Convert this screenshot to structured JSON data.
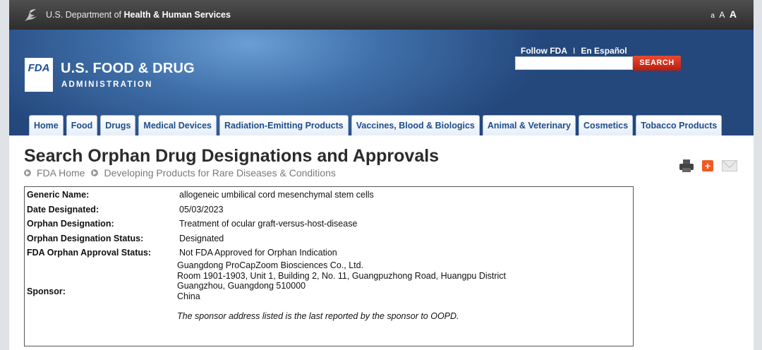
{
  "hhs": {
    "prefix": "U.S. Department of ",
    "name": "Health & Human Services",
    "text_size": [
      "a",
      "A",
      "A"
    ]
  },
  "header": {
    "logo_mark": "FDA",
    "title": "U.S. FOOD & DRUG",
    "subtitle": "ADMINISTRATION",
    "follow": "Follow FDA",
    "separator": "I",
    "espanol": "En Español",
    "search_placeholder": "",
    "search_button": "SEARCH"
  },
  "nav": {
    "tabs": [
      {
        "label": "Home"
      },
      {
        "label": "Food"
      },
      {
        "label": "Drugs"
      },
      {
        "label": "Medical Devices"
      },
      {
        "label": "Radiation-Emitting Products"
      },
      {
        "label": "Vaccines, Blood & Biologics"
      },
      {
        "label": "Animal & Veterinary"
      },
      {
        "label": "Cosmetics"
      },
      {
        "label": "Tobacco Products"
      }
    ]
  },
  "main": {
    "title": "Search Orphan Drug Designations and Approvals",
    "breadcrumb": [
      "FDA Home",
      "Developing Products for Rare Diseases & Conditions"
    ],
    "tools": [
      "printer-icon",
      "plus-icon",
      "email-icon"
    ]
  },
  "details": {
    "generic_name": {
      "label": "Generic Name:",
      "value": "allogeneic umbilical cord mesenchymal stem cells"
    },
    "date_designated": {
      "label": "Date Designated:",
      "value": "05/03/2023"
    },
    "orphan_designation": {
      "label": "Orphan Designation:",
      "value": "Treatment of ocular graft-versus-host-disease"
    },
    "designation_status": {
      "label": "Orphan Designation Status:",
      "value": "Designated"
    },
    "approval_status": {
      "label": "FDA Orphan Approval Status:",
      "value": "Not FDA Approved for Orphan Indication"
    },
    "sponsor": {
      "label": "Sponsor:",
      "lines": [
        "Guangdong ProCapZoom Biosciences Co., Ltd.",
        "Room 1901-1903, Unit 1, Building 2, No. 11, Guangpuzhong Road, Huangpu District",
        "Guangzhou, Guangdong 510000",
        "China"
      ],
      "note": "The sponsor address listed is the last reported by the sponsor to OOPD."
    }
  },
  "colors": {
    "nav_text": "#1f4e8c",
    "search_button": "#d0311f",
    "header_blue": "#24477c"
  }
}
